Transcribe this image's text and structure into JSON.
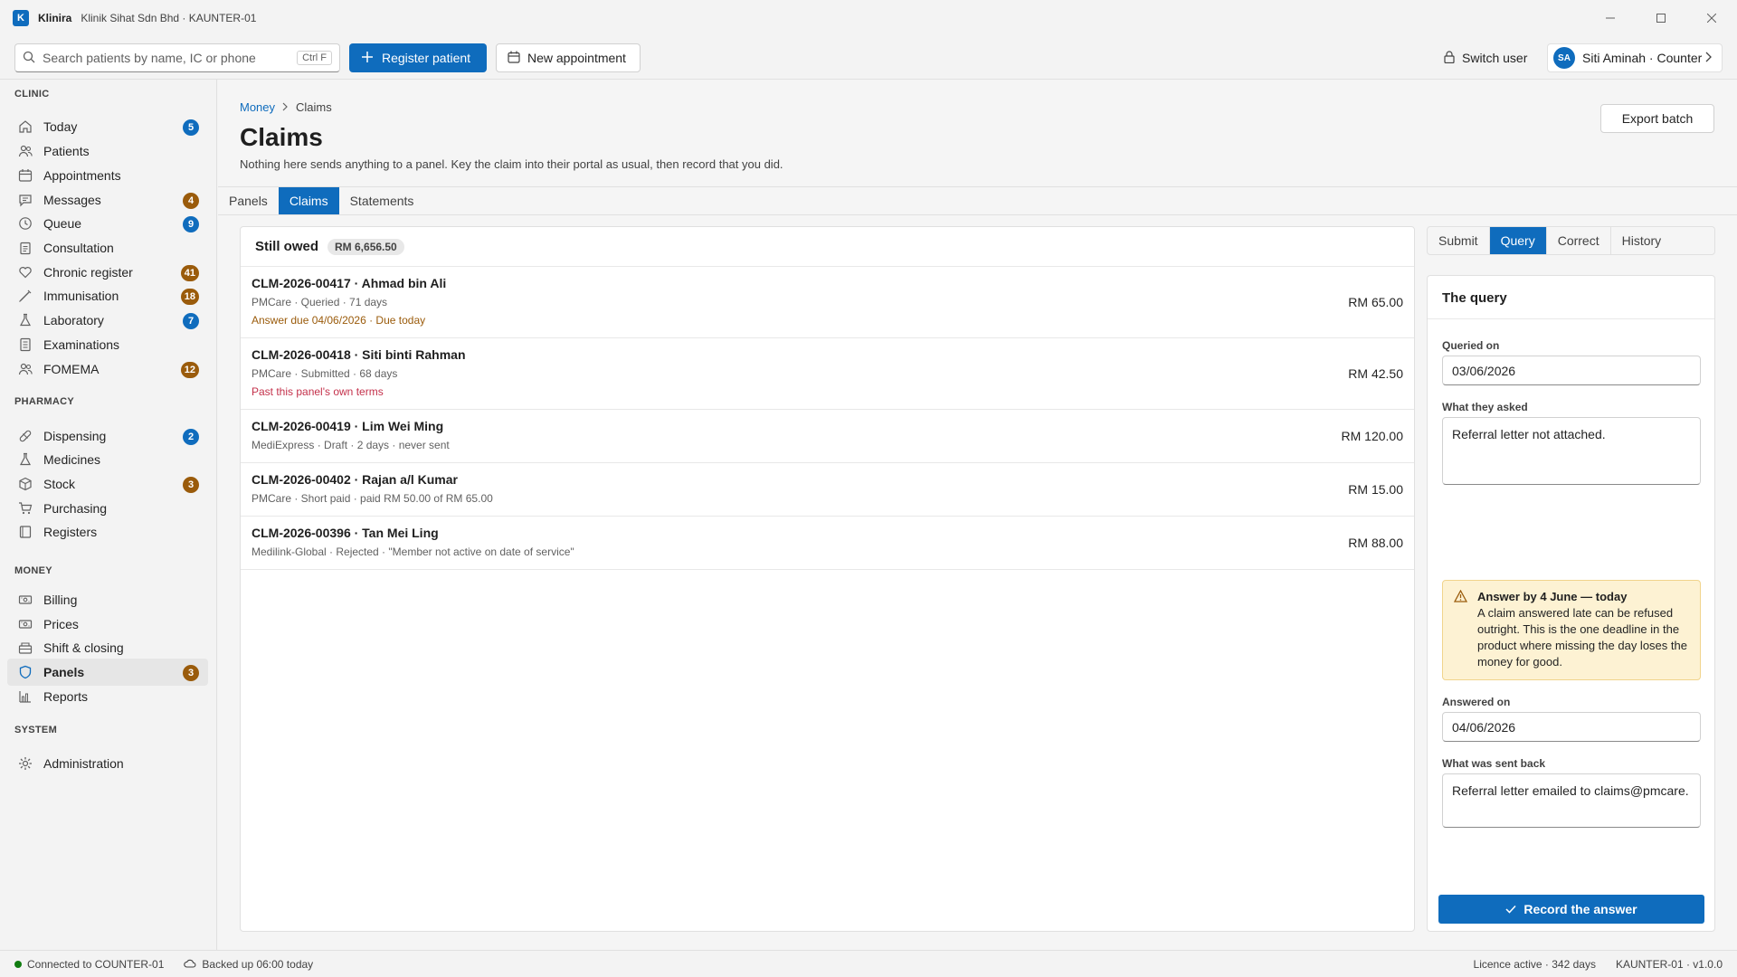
{
  "window": {
    "app_name": "Klinira",
    "subtitle": "Klinik Sihat Sdn Bhd · KAUNTER-01",
    "logo_letter": "K"
  },
  "toolbar": {
    "search_placeholder": "Search patients by name, IC or phone",
    "search_shortcut": "Ctrl F",
    "register_label": "Register patient",
    "appointment_label": "New appointment",
    "switch_user_label": "Switch user",
    "user_initials": "SA",
    "user_label": "Siti Aminah · Counter"
  },
  "sidebar": {
    "sections": [
      {
        "title": "CLINIC",
        "items": [
          {
            "label": "Today",
            "icon": "home-icon",
            "badge": "5",
            "badge_color": "blue"
          },
          {
            "label": "Patients",
            "icon": "people-icon",
            "badge": "",
            "badge_color": ""
          },
          {
            "label": "Appointments",
            "icon": "calendar-icon",
            "badge": "",
            "badge_color": ""
          },
          {
            "label": "Messages",
            "icon": "chat-icon",
            "badge": "4",
            "badge_color": "amber"
          },
          {
            "label": "Queue",
            "icon": "clock-icon",
            "badge": "9",
            "badge_color": "blue"
          },
          {
            "label": "Consultation",
            "icon": "clipboard-icon",
            "badge": "",
            "badge_color": ""
          },
          {
            "label": "Chronic register",
            "icon": "heart-icon",
            "badge": "41",
            "badge_color": "amber"
          },
          {
            "label": "Immunisation",
            "icon": "syringe-icon",
            "badge": "18",
            "badge_color": "amber"
          },
          {
            "label": "Laboratory",
            "icon": "flask-icon",
            "badge": "7",
            "badge_color": "blue"
          },
          {
            "label": "Examinations",
            "icon": "document-icon",
            "badge": "",
            "badge_color": ""
          },
          {
            "label": "FOMEMA",
            "icon": "people-icon",
            "badge": "12",
            "badge_color": "amber"
          }
        ]
      },
      {
        "title": "PHARMACY",
        "items": [
          {
            "label": "Dispensing",
            "icon": "pill-icon",
            "badge": "2",
            "badge_color": "blue"
          },
          {
            "label": "Medicines",
            "icon": "flask-icon",
            "badge": "",
            "badge_color": ""
          },
          {
            "label": "Stock",
            "icon": "box-icon",
            "badge": "3",
            "badge_color": "amber"
          },
          {
            "label": "Purchasing",
            "icon": "cart-icon",
            "badge": "",
            "badge_color": ""
          },
          {
            "label": "Registers",
            "icon": "book-icon",
            "badge": "",
            "badge_color": ""
          }
        ]
      },
      {
        "title": "MONEY",
        "items": [
          {
            "label": "Billing",
            "icon": "money-icon",
            "badge": "",
            "badge_color": ""
          },
          {
            "label": "Prices",
            "icon": "money-icon",
            "badge": "",
            "badge_color": ""
          },
          {
            "label": "Shift & closing",
            "icon": "drawer-icon",
            "badge": "",
            "badge_color": ""
          },
          {
            "label": "Panels",
            "icon": "shield-icon",
            "badge": "3",
            "badge_color": "amber",
            "active": true
          },
          {
            "label": "Reports",
            "icon": "chart-icon",
            "badge": "",
            "badge_color": ""
          }
        ]
      },
      {
        "title": "SYSTEM",
        "items": [
          {
            "label": "Administration",
            "icon": "gear-icon",
            "badge": "",
            "badge_color": ""
          }
        ]
      }
    ]
  },
  "main": {
    "breadcrumb": {
      "parent": "Money",
      "current": "Claims"
    },
    "title": "Claims",
    "subtitle": "Nothing here sends anything to a panel. Key the claim into their portal as usual, then record that you did.",
    "export_label": "Export batch",
    "tabs": [
      "Panels",
      "Claims",
      "Statements"
    ],
    "active_tab": "Claims"
  },
  "claims": {
    "heading": "Still owed",
    "total": "RM 6,656.50",
    "rows": [
      {
        "title": "CLM-2026-00417 · Ahmad bin Ali",
        "meta": "PMCare · Queried · 71 days",
        "warn": "Answer due 04/06/2026 · Due today",
        "warn_color": "#9a5b0b",
        "amount": "RM 65.00"
      },
      {
        "title": "CLM-2026-00418 · Siti binti Rahman",
        "meta": "PMCare · Submitted · 68 days",
        "warn": "Past this panel's own terms",
        "warn_color": "#c4314b",
        "amount": "RM 42.50"
      },
      {
        "title": "CLM-2026-00419 · Lim Wei Ming",
        "meta": "MediExpress · Draft · 2 days · never sent",
        "warn": "",
        "warn_color": "",
        "amount": "RM 120.00"
      },
      {
        "title": "CLM-2026-00402 · Rajan a/l Kumar",
        "meta": "PMCare · Short paid · paid RM 50.00 of RM 65.00",
        "warn": "",
        "warn_color": "",
        "amount": "RM 15.00"
      },
      {
        "title": "CLM-2026-00396 · Tan Mei Ling",
        "meta": "Medilink-Global · Rejected · \"Member not active on date of service\"",
        "warn": "",
        "warn_color": "",
        "amount": "RM 88.00"
      }
    ]
  },
  "detail": {
    "tabs": [
      "Submit",
      "Query",
      "Correct",
      "History"
    ],
    "active_tab": "Query",
    "title": "The query",
    "queried_on_label": "Queried on",
    "queried_on": "03/06/2026",
    "asked_label": "What they asked",
    "asked": "Referral letter not attached.",
    "warning_title": "Answer by 4 June — today",
    "warning_text": "A claim answered late can be refused outright. This is the one deadline in the product where missing the day loses the money for good.",
    "answered_on_label": "Answered on",
    "answered_on": "04/06/2026",
    "sent_back_label": "What was sent back",
    "sent_back": "Referral letter emailed to claims@pmcare.",
    "record_label": "Record the answer"
  },
  "status": {
    "connection": "Connected to COUNTER-01",
    "backup": "Backed up 06:00 today",
    "licence": "Licence active · 342 days",
    "version": "KAUNTER-01 · v1.0.0"
  },
  "colors": {
    "accent": "#0f6cbd",
    "amber": "#9a5b0b",
    "danger": "#c4314b",
    "success": "#107c10"
  }
}
